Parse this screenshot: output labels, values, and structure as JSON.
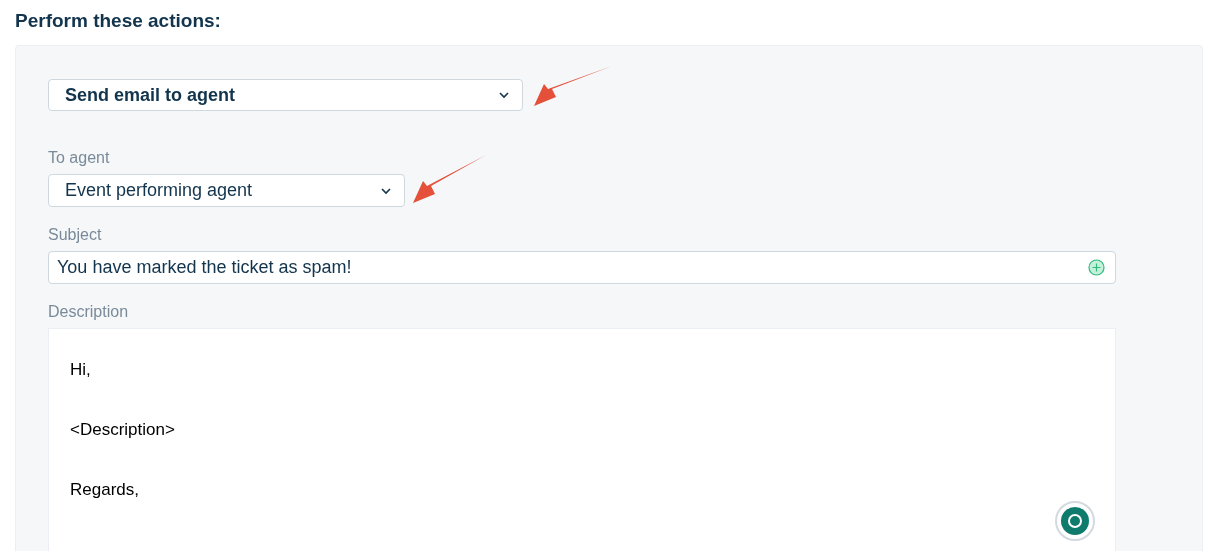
{
  "heading": "Perform these actions:",
  "action_select": {
    "value": "Send email to agent"
  },
  "to_agent": {
    "label": "To agent",
    "value": "Event performing agent"
  },
  "subject": {
    "label": "Subject",
    "value": "You have marked the ticket as spam!"
  },
  "description": {
    "label": "Description",
    "lines": [
      "Hi,",
      "<Description>",
      "Regards,"
    ]
  },
  "annotations": [
    {
      "kind": "arrow"
    },
    {
      "kind": "arrow"
    }
  ]
}
